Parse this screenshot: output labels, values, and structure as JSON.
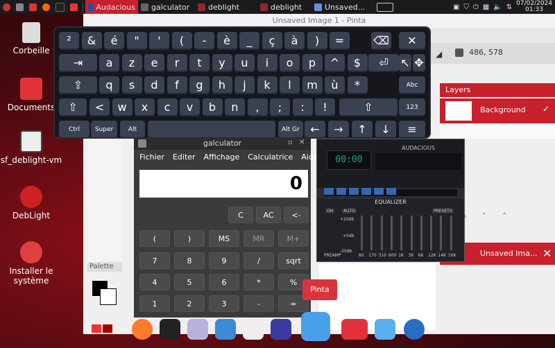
{
  "taskbar": {
    "items": [
      {
        "label": "Audacious",
        "active": true
      },
      {
        "label": "galculator"
      },
      {
        "label": "deblight"
      },
      {
        "label": "deblight"
      },
      {
        "label": "Unsaved..."
      }
    ],
    "date": "07/02/2024",
    "time": "01:33"
  },
  "desktop": {
    "icons": [
      "Corbeille",
      "Documents",
      "sf_deblight-vm",
      "DebLight",
      "Installer le système"
    ]
  },
  "pinta": {
    "title": "Unsaved Image 1 - Pinta",
    "coords": "486, 578",
    "layers_title": "Layers",
    "layer_name": "Background",
    "palette_title": "Palette",
    "tab_label": "Unsaved Ima...",
    "tooltip": "Pinta"
  },
  "keyboard": {
    "row1": [
      "²",
      "&",
      "é",
      "\"",
      "'",
      "(",
      "-",
      "è",
      "_",
      "ç",
      "à",
      ")",
      "="
    ],
    "row2": [
      "a",
      "z",
      "e",
      "r",
      "t",
      "y",
      "u",
      "i",
      "o",
      "p",
      "^",
      "$"
    ],
    "row3": [
      "q",
      "s",
      "d",
      "f",
      "g",
      "h",
      "j",
      "k",
      "l",
      "m",
      "ù",
      "*"
    ],
    "row4": [
      "<",
      "w",
      "x",
      "c",
      "v",
      "b",
      "n",
      ",",
      ";",
      ":",
      "!"
    ],
    "labels": {
      "ctrl": "Ctrl",
      "super": "Super",
      "alt": "Alt",
      "altgr": "Alt Gr",
      "abc": "Abc",
      "num": "123"
    }
  },
  "galculator": {
    "title": "galculator",
    "menu": [
      "Fichier",
      "Editer",
      "Affichage",
      "Calculatrice",
      "Aide"
    ],
    "display": "0",
    "row_top": [
      "C",
      "AC",
      "<-"
    ],
    "row_mem": [
      "(",
      ")",
      "MS",
      "MR",
      "M+"
    ],
    "rows": [
      [
        "7",
        "8",
        "9",
        "/",
        "sqrt"
      ],
      [
        "4",
        "5",
        "6",
        "*",
        "%"
      ],
      [
        "1",
        "2",
        "3",
        "-",
        "="
      ]
    ]
  },
  "audacious": {
    "title": "AUDACIOUS",
    "eq_title": "EQUALIZER",
    "eq_on": "ON",
    "eq_auto": "AUTO",
    "eq_presets": "PRESETS",
    "eq_db": [
      "+20db",
      "+0db",
      "-20db"
    ],
    "eq_preamp": "PREAMP",
    "eq_bands": [
      "60",
      "170",
      "310",
      "600",
      "1K",
      "3K",
      "6K",
      "12K",
      "14K",
      "16K"
    ],
    "time": "00:00"
  }
}
